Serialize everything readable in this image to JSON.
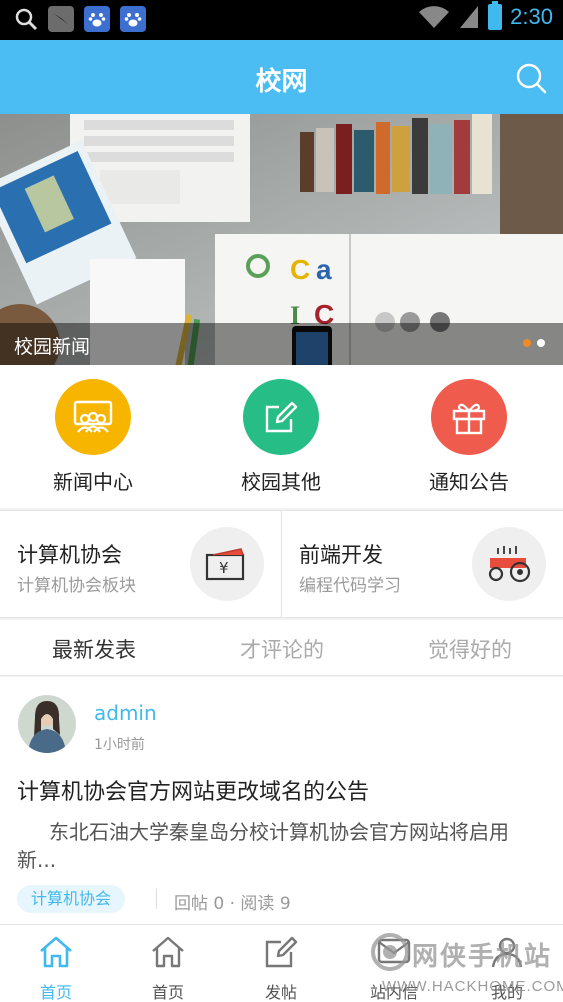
{
  "statusbar": {
    "time": "2:30"
  },
  "header": {
    "title": "校网"
  },
  "banner": {
    "caption": "校园新闻",
    "dots": 2,
    "active_dot": 2
  },
  "categories": [
    {
      "label": "新闻中心",
      "color": "#f7b500",
      "icon": "people-board-icon"
    },
    {
      "label": "校园其他",
      "color": "#27bd86",
      "icon": "edit-icon"
    },
    {
      "label": "通知公告",
      "color": "#ef5b4c",
      "icon": "gift-icon"
    }
  ],
  "boards": [
    {
      "title": "计算机协会",
      "subtitle": "计算机协会板块",
      "icon": "money-envelope-icon"
    },
    {
      "title": "前端开发",
      "subtitle": "编程代码学习",
      "icon": "tractor-icon"
    }
  ],
  "tabs": [
    {
      "label": "最新发表",
      "active": true
    },
    {
      "label": "才评论的",
      "active": false
    },
    {
      "label": "觉得好的",
      "active": false
    }
  ],
  "post": {
    "author": "admin",
    "time": "1小时前",
    "title": "计算机协会官方网站更改域名的公告",
    "excerpt": "东北石油大学秦皇岛分校计算机协会官方网站将启用新...",
    "tag": "计算机协会",
    "stats": "回帖 0 · 阅读 9"
  },
  "bottomnav": [
    {
      "label": "首页",
      "active": true
    },
    {
      "label": "首页",
      "active": false
    },
    {
      "label": "发帖",
      "active": false
    },
    {
      "label": "站内信",
      "active": false
    },
    {
      "label": "我的",
      "active": false
    }
  ],
  "watermark": {
    "line1": "网侠手机站",
    "line2": "WWW.HACKHOME.COM"
  },
  "colors": {
    "accent": "#40b9ee",
    "header": "#4bbdf3"
  }
}
